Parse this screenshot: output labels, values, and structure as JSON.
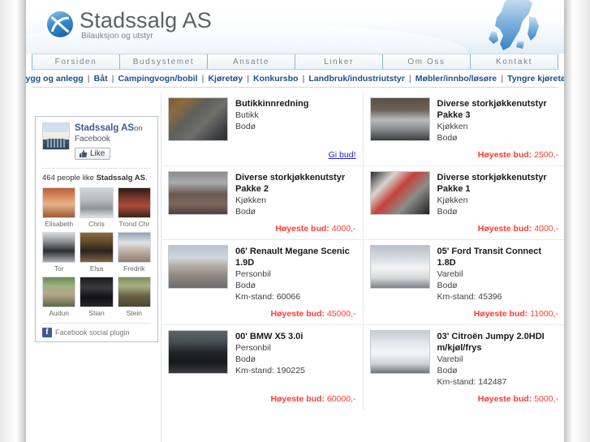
{
  "brand": {
    "title": "Stadssalg AS",
    "tagline": "Bilauksjon og utstyr",
    "logo_icon": "circle-slash-logo-icon",
    "map_icon": "scandinavia-map-icon",
    "accent_color": "#1c4f8c",
    "bid_color": "#ff3b30",
    "link_color": "#2222cc"
  },
  "nav_main": [
    {
      "label": "Forsiden"
    },
    {
      "label": "Budsystemet"
    },
    {
      "label": "Ansatte"
    },
    {
      "label": "Linker"
    },
    {
      "label": "Om Oss"
    },
    {
      "label": "Kontakt"
    }
  ],
  "nav_sub": [
    {
      "label": "Bygg og anlegg"
    },
    {
      "label": "Båt"
    },
    {
      "label": "Campingvogn/bobil"
    },
    {
      "label": "Kjøretøy"
    },
    {
      "label": "Konkursbo"
    },
    {
      "label": "Landbruk/industriutstyr"
    },
    {
      "label": "Møbler/innbo/løsøre"
    },
    {
      "label": "Tyngre kjøretøy"
    }
  ],
  "nav_sub_separator": "|",
  "facebook": {
    "page_name": "Stadssalg AS",
    "on_word": "on",
    "network": "Facebook",
    "like_label": "Like",
    "like_icon": "thumbs-up-icon",
    "page_thumb_icon": "page-logo-thumbnail",
    "count_text_prefix": "464 people like ",
    "count_text_name": "Stadssalg AS",
    "count_text_suffix": ".",
    "faces": [
      {
        "name": "Elisabeth",
        "art": "f-elisabeth"
      },
      {
        "name": "Chris",
        "art": "f-chris"
      },
      {
        "name": "Trond Chr",
        "art": "f-trond"
      },
      {
        "name": "Tor",
        "art": "f-tor"
      },
      {
        "name": "Elsa",
        "art": "f-elsa"
      },
      {
        "name": "Fredrik",
        "art": "f-fredrik"
      },
      {
        "name": "Audun",
        "art": "f-audun"
      },
      {
        "name": "Stian",
        "art": "f-stian"
      },
      {
        "name": "Stein",
        "art": "f-stein"
      }
    ],
    "footer_label": "Facebook social plugin",
    "footer_icon": "facebook-f-icon"
  },
  "listings": [
    [
      {
        "title": "Butikkinnredning",
        "category": "Butikk",
        "location": "Bodø",
        "odometer": "",
        "footer_type": "link",
        "footer_text": "Gi bud!",
        "thumb_icon": "shop-interior-photo",
        "thumb_art": "t-shop"
      },
      {
        "title": "Diverse storkjøkkenutstyr Pakke 3",
        "category": "Kjøkken",
        "location": "Bodø",
        "odometer": "",
        "footer_type": "bid",
        "footer_label": "Høyeste bud:",
        "footer_amount": "2500,-",
        "thumb_icon": "kitchen-equipment-photo",
        "thumb_art": "t-kitch3"
      }
    ],
    [
      {
        "title": "Diverse storkjøkkenutstyr Pakke 2",
        "category": "Kjøkken",
        "location": "Bodø",
        "odometer": "",
        "footer_type": "bid",
        "footer_label": "Høyeste bud:",
        "footer_amount": "4000,-",
        "thumb_icon": "kitchen-equipment-photo",
        "thumb_art": "t-kitch2"
      },
      {
        "title": "Diverse storkjøkkenutstyr Pakke 1",
        "category": "Kjøkken",
        "location": "Bodø",
        "odometer": "",
        "footer_type": "bid",
        "footer_label": "Høyeste bud:",
        "footer_amount": "4000,-",
        "thumb_icon": "kitchen-equipment-photo",
        "thumb_art": "t-kitch1"
      }
    ],
    [
      {
        "title": "06' Renault Megane Scenic 1.9D",
        "category": "Personbil",
        "location": "Bodø",
        "odometer": "Km-stand: 60066",
        "footer_type": "bid",
        "footer_label": "Høyeste bud:",
        "footer_amount": "45000,-",
        "thumb_icon": "car-photo",
        "thumb_art": "t-renault"
      },
      {
        "title": "05' Ford Transit Connect 1.8D",
        "category": "Varebil",
        "location": "Bodø",
        "odometer": "Km-stand: 45396",
        "footer_type": "bid",
        "footer_label": "Høyeste bud:",
        "footer_amount": "11000,-",
        "thumb_icon": "van-photo",
        "thumb_art": "t-ford"
      }
    ],
    [
      {
        "title": "00' BMW X5 3.0i",
        "category": "Personbil",
        "location": "Bodø",
        "odometer": "Km-stand: 190225",
        "footer_type": "bid",
        "footer_label": "Høyeste bud:",
        "footer_amount": "60000,-",
        "thumb_icon": "car-photo",
        "thumb_art": "t-bmw"
      },
      {
        "title": "03' Citroën Jumpy 2.0HDI m/kjøl/frys",
        "category": "Varebil",
        "location": "Bodø",
        "odometer": "Km-stand: 142487",
        "footer_type": "bid",
        "footer_label": "Høyeste bud:",
        "footer_amount": "5000,-",
        "thumb_icon": "van-photo",
        "thumb_art": "t-citroen"
      }
    ]
  ]
}
